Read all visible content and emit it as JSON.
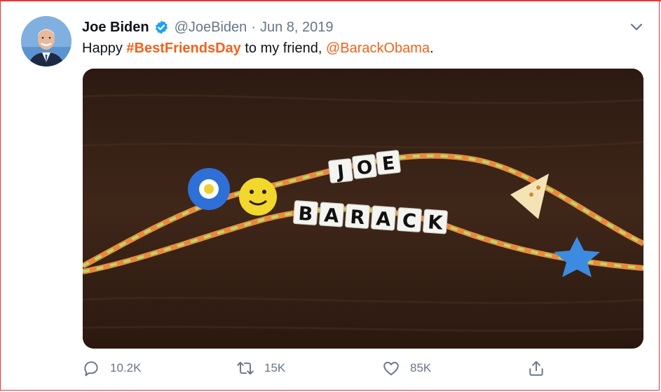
{
  "tweet": {
    "author_name": "Joe Biden",
    "handle": "@JoeBiden",
    "separator": "·",
    "date": "Jun 8, 2019",
    "text_prefix": "Happy ",
    "hashtag": "#BestFriendsDay",
    "text_middle": " to my friend, ",
    "mention": "@BarackObama",
    "text_suffix": ".",
    "image_bead_labels": {
      "top": [
        "J",
        "O",
        "E"
      ],
      "bottom": [
        "B",
        "A",
        "R",
        "A",
        "C",
        "K"
      ]
    }
  },
  "actions": {
    "reply_count": "10.2K",
    "retweet_count": "15K",
    "like_count": "85K"
  },
  "colors": {
    "accent": "#f3611b",
    "verified": "#1da1f2",
    "muted": "#657786",
    "frame": "#e8363a"
  },
  "icons": {
    "verified": "verified-badge-icon",
    "more": "chevron-down-icon",
    "reply": "reply-icon",
    "retweet": "retweet-icon",
    "like": "heart-icon",
    "share": "share-icon"
  }
}
